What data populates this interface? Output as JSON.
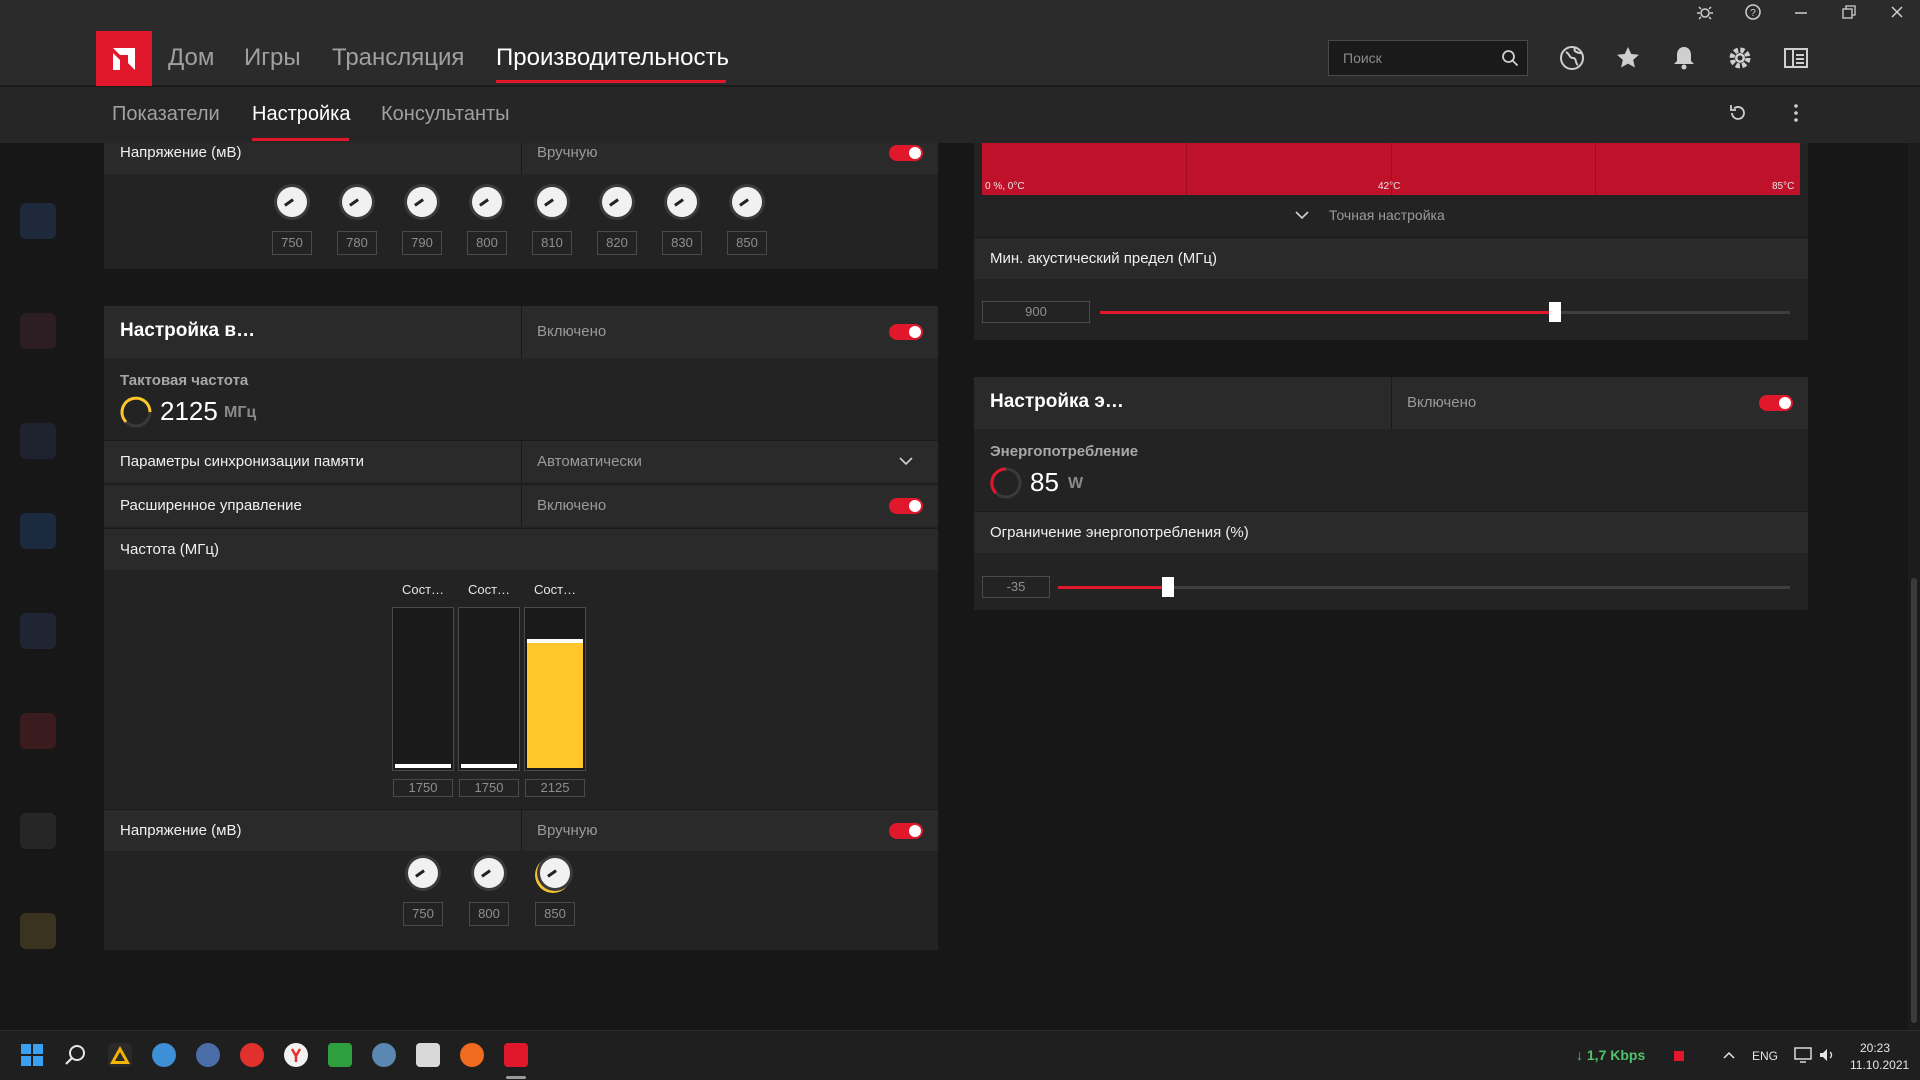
{
  "nav": {
    "tabs": [
      "Дом",
      "Игры",
      "Трансляция",
      "Производительность"
    ],
    "active_index": 3,
    "search_placeholder": "Поиск"
  },
  "subnav": {
    "tabs": [
      "Показатели",
      "Настройка",
      "Консультанты"
    ],
    "active_index": 1
  },
  "left": {
    "voltage_top": {
      "label": "Напряжение (мВ)",
      "mode": "Вручную",
      "values": [
        "750",
        "780",
        "790",
        "800",
        "810",
        "820",
        "830",
        "850"
      ]
    },
    "vram": {
      "title": "Настройка в…",
      "status": "Включено",
      "clock_label": "Тактовая частота",
      "clock_value": "2125",
      "clock_unit": "МГц",
      "memory_timing_label": "Параметры синхронизации памяти",
      "memory_timing_value": "Автоматически",
      "advanced_label": "Расширенное управление",
      "advanced_value": "Включено",
      "freq_label": "Частота (МГц)",
      "states": [
        {
          "label": "Сост…",
          "value": "1750",
          "fill": 0.0
        },
        {
          "label": "Сост…",
          "value": "1750",
          "fill": 0.0
        },
        {
          "label": "Сост…",
          "value": "2125",
          "fill": 0.78
        }
      ],
      "voltage_label": "Напряжение (мВ)",
      "voltage_mode": "Вручную",
      "voltage_values": [
        "750",
        "800",
        "850"
      ]
    }
  },
  "right": {
    "fan_curve": {
      "tick_left": "0 %, 0°C",
      "tick_mid": "42°C",
      "tick_right": "85°C",
      "fine_tune": "Точная настройка",
      "min_acoustic_label": "Мин. акустический предел (МГц)",
      "min_acoustic_value": "900",
      "min_acoustic_fraction": 0.66
    },
    "power": {
      "title": "Настройка э…",
      "status": "Включено",
      "consumption_label": "Энергопотребление",
      "consumption_value": "85",
      "consumption_unit": "W",
      "limit_label": "Ограничение энергопотребления (%)",
      "limit_value": "-35",
      "limit_fraction": 0.15
    }
  },
  "taskbar": {
    "net_speed": "↓ 1,7 Kbps",
    "lang": "ENG",
    "time": "20:23",
    "date": "11.10.2021"
  },
  "colors": {
    "accent": "#e1182c",
    "yellow": "#ffc72c"
  }
}
